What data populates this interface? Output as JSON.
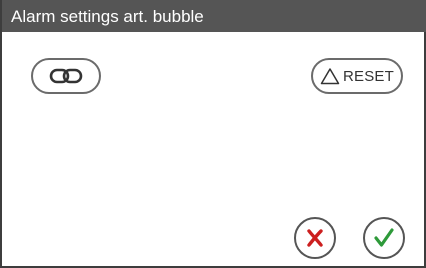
{
  "window": {
    "title": "Alarm settings art. bubble"
  },
  "toolbar": {
    "link_icon": "link-icon",
    "reset_icon": "warning-triangle-icon",
    "reset_label": "RESET"
  },
  "footer": {
    "cancel_icon": "cross-icon",
    "confirm_icon": "check-icon"
  },
  "colors": {
    "title_bar": "#555555",
    "cancel": "#cc1f1f",
    "confirm": "#2e9a3a"
  }
}
